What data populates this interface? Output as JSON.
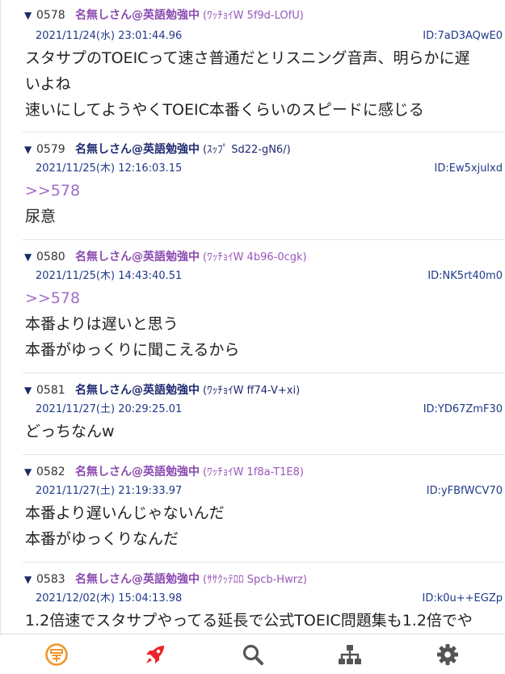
{
  "toggle_glyph": "▼",
  "posts": [
    {
      "number": "0578",
      "name": "名無しさん@英語勉強中",
      "trip": "(ﾜｯﾁｮｲW 5f9d-LOfU)",
      "datetime": "2021/11/24(水) 23:01:44.96",
      "id": "ID:7aD3AQwE0",
      "lines": [
        "スタサプのTOEICって速さ普通だとリスニング音声、明らかに遅",
        "いよね",
        "速いにしてようやくTOEIC本番くらいのスピードに感じる"
      ]
    },
    {
      "number": "0579",
      "name": "名無しさん@英語勉強中",
      "trip": "(ｽｯﾌﾟ Sd22-gN6/)",
      "datetime": "2021/11/25(木) 12:16:03.15",
      "id": "ID:Ew5xjulxd",
      "anchor": ">>578",
      "lines": [
        "尿意"
      ]
    },
    {
      "number": "0580",
      "name": "名無しさん@英語勉強中",
      "trip": "(ﾜｯﾁｮｲW 4b96-0cgk)",
      "datetime": "2021/11/25(木) 14:43:40.51",
      "id": "ID:NK5rt40m0",
      "anchor": ">>578",
      "lines": [
        "本番よりは遅いと思う",
        "本番がゆっくりに聞こえるから"
      ]
    },
    {
      "number": "0581",
      "name": "名無しさん@英語勉強中",
      "trip": "(ﾜｯﾁｮｲW ff74-V+xi)",
      "datetime": "2021/11/27(土) 20:29:25.01",
      "id": "ID:YD67ZmF30",
      "lines": [
        "どっちなんw"
      ]
    },
    {
      "number": "0582",
      "name": "名無しさん@英語勉強中",
      "trip": "(ﾜｯﾁｮｲW 1f8a-T1E8)",
      "datetime": "2021/11/27(土) 21:19:33.97",
      "id": "ID:yFBfWCV70",
      "lines": [
        "本番より遅いんじゃないんだ",
        "本番がゆっくりなんだ"
      ]
    },
    {
      "number": "0583",
      "name": "名無しさん@英語勉強中",
      "trip": "(ｻｻｸｯﾃﾛﾛ Spcb-Hwrz)",
      "datetime": "2021/12/02(木) 15:04:13.98",
      "id": "ID:k0u++EGZp",
      "lines": [
        "1.2倍速でスタサプやってる延長で公式TOEIC問題集も1.2倍でや"
      ]
    }
  ],
  "tabbar": {
    "items": [
      {
        "icon": "logo-icon",
        "color": "#f0962d"
      },
      {
        "icon": "rocket-icon",
        "color": "#e8262b"
      },
      {
        "icon": "search-icon",
        "color": "#555555"
      },
      {
        "icon": "sitemap-icon",
        "color": "#555555"
      },
      {
        "icon": "gear-icon",
        "color": "#555555"
      }
    ]
  }
}
